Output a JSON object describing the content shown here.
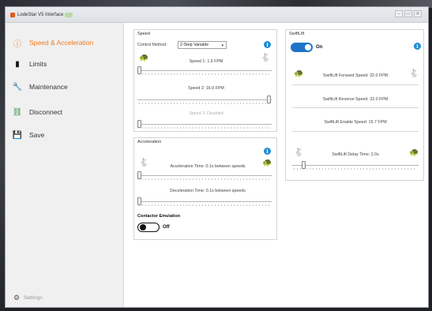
{
  "window": {
    "title": "LodeStar V5 Interface",
    "buttons": {
      "minimize": "–",
      "maximize": "▭",
      "close": "✕"
    }
  },
  "sidebar": {
    "items": [
      {
        "label": "Speed & Acceleration",
        "icon": "alert-circle-icon",
        "glyph": "ⓘ"
      },
      {
        "label": "Limits",
        "icon": "limits-icon",
        "glyph": "▮"
      },
      {
        "label": "Maintenance",
        "icon": "wrench-icon",
        "glyph": "🔧"
      },
      {
        "label": "Disconnect",
        "icon": "disconnect-icon",
        "glyph": "⛓"
      },
      {
        "label": "Save",
        "icon": "save-icon",
        "glyph": "💾"
      }
    ],
    "settings_label": "Settings"
  },
  "speed": {
    "title": "Speed",
    "control_method_label": "Control Method:",
    "control_method_value": "2-Step Variable",
    "speed1": "Speed 1: 1.6 FPM",
    "speed2": "Speed 2: 16.0 FPM",
    "speed3": "Speed 3: Disabled"
  },
  "acceleration": {
    "title": "Acceleration",
    "accel_time": "Acceleration Time: 0.1s between speeds",
    "decel_time": "Deceleration Time: 0.1s between speeds",
    "contactor_label": "Contactor Emulation",
    "contactor_state": "Off"
  },
  "swiftlift": {
    "title": "SwiftLift",
    "state": "On",
    "forward_speed": "SwiftLift Forward Speed: 32.0 FPM",
    "reverse_speed": "SwiftLift Reverse Speed: 32.0 FPM",
    "enable_speed": "SwiftLift Enable Speed: 15.7 FPM",
    "delay_time": "SwiftLift Delay Time: 2.0s"
  },
  "colors": {
    "accent": "#f07b20",
    "info_blue": "#1f8dd6",
    "toggle_blue": "#1f74c8"
  }
}
